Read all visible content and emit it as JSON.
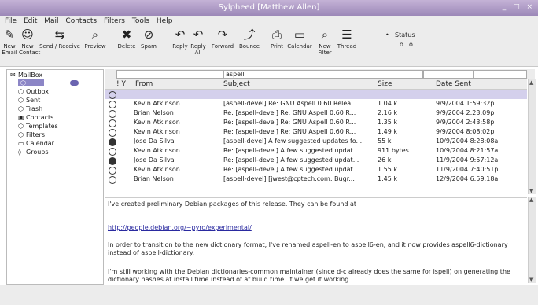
{
  "window": {
    "title": "Sylpheed [Matthew Allen]"
  },
  "menu": [
    "File",
    "Edit",
    "Mail",
    "Contacts",
    "Filters",
    "Tools",
    "Help"
  ],
  "toolbar": {
    "buttons": [
      {
        "label": "New Email",
        "icon": "new-email-icon"
      },
      {
        "label": "New Contact",
        "icon": "new-contact-icon"
      },
      {
        "label": "Send / Receive",
        "icon": "send-receive-icon"
      },
      {
        "label": "Preview",
        "icon": "preview-icon"
      },
      {
        "label": "Delete",
        "icon": "delete-icon"
      },
      {
        "label": "Spam",
        "icon": "spam-icon"
      },
      {
        "label": "Reply",
        "icon": "reply-icon"
      },
      {
        "label": "Reply All",
        "icon": "reply-all-icon"
      },
      {
        "label": "Forward",
        "icon": "forward-icon"
      },
      {
        "label": "Bounce",
        "icon": "bounce-icon"
      },
      {
        "label": "Print",
        "icon": "print-icon"
      },
      {
        "label": "Calendar",
        "icon": "calendar-icon"
      },
      {
        "label": "New Filter",
        "icon": "new-filter-icon"
      },
      {
        "label": "Thread",
        "icon": "thread-icon"
      }
    ],
    "status_label": "Status",
    "status_options": [
      "o",
      "o"
    ]
  },
  "folders": {
    "root": "MailBox",
    "items": [
      {
        "label": "",
        "selected": true
      },
      {
        "label": "Outbox"
      },
      {
        "label": "Sent"
      },
      {
        "label": "Trash"
      },
      {
        "label": "Contacts"
      },
      {
        "label": "Templates"
      },
      {
        "label": "Filters"
      },
      {
        "label": "Calendar"
      },
      {
        "label": "Groups"
      }
    ]
  },
  "search": {
    "subject_value": "aspell"
  },
  "columns": {
    "flag": "! Y",
    "from": "From",
    "subject": "Subject",
    "size": "Size",
    "date": "Date Sent"
  },
  "messages": [
    {
      "from": "",
      "subject": "",
      "size": "",
      "date": "",
      "highlight": true,
      "dark": false
    },
    {
      "from": "Kevin Atkinson",
      "subject": "[aspell-devel] Re: GNU Aspell 0.60 Relea...",
      "size": "1.04 k",
      "date": "9/9/2004 1:59:32p",
      "highlight": false,
      "dark": false
    },
    {
      "from": "Brian Nelson",
      "subject": "Re: [aspell-devel] Re: GNU Aspell 0.60 R...",
      "size": "2.16 k",
      "date": "9/9/2004 2:23:09p",
      "highlight": false,
      "dark": false
    },
    {
      "from": "Kevin Atkinson",
      "subject": "Re: [aspell-devel] Re: GNU Aspell 0.60 R...",
      "size": "1.35 k",
      "date": "9/9/2004 2:43:58p",
      "highlight": false,
      "dark": false
    },
    {
      "from": "Kevin Atkinson",
      "subject": "Re: [aspell-devel] Re: GNU Aspell 0.60 R...",
      "size": "1.49 k",
      "date": "9/9/2004 8:08:02p",
      "highlight": false,
      "dark": false
    },
    {
      "from": "Jose Da Silva",
      "subject": "[aspell-devel] A few suggested updates fo...",
      "size": "55 k",
      "date": "10/9/2004 8:28:08a",
      "highlight": false,
      "dark": true
    },
    {
      "from": "Kevin Atkinson",
      "subject": "Re: [aspell-devel] A few suggested updat...",
      "size": "911 bytes",
      "date": "10/9/2004 8:21:57a",
      "highlight": false,
      "dark": false
    },
    {
      "from": "Jose Da Silva",
      "subject": "Re: [aspell-devel] A few suggested updat...",
      "size": "26 k",
      "date": "11/9/2004 9:57:12a",
      "highlight": false,
      "dark": true
    },
    {
      "from": "Kevin Atkinson",
      "subject": "Re: [aspell-devel] A few suggested updat...",
      "size": "1.55 k",
      "date": "11/9/2004 7:40:51p",
      "highlight": false,
      "dark": false
    },
    {
      "from": "Brian Nelson",
      "subject": "[aspell-devel] [jwest@cptech.com: Bugr...",
      "size": "1.45 k",
      "date": "12/9/2004 6:59:18a",
      "highlight": false,
      "dark": false
    }
  ],
  "preview": {
    "p1": "I've created preliminary Debian packages of this release.  They can be found at",
    "link": "http://people.debian.org/~pyro/experimental/",
    "p2": "In order to transition to the new dictionary format, I've renamed aspell-en to aspell6-en, and it now provides aspell6-dictionary instead of aspell-dictionary.",
    "p3": "I'm still working with the Debian dictionaries-common maintainer (since d-c already does the same for ispell) on generating the dictionary hashes at install time instead of at build time.  If we get it working"
  }
}
